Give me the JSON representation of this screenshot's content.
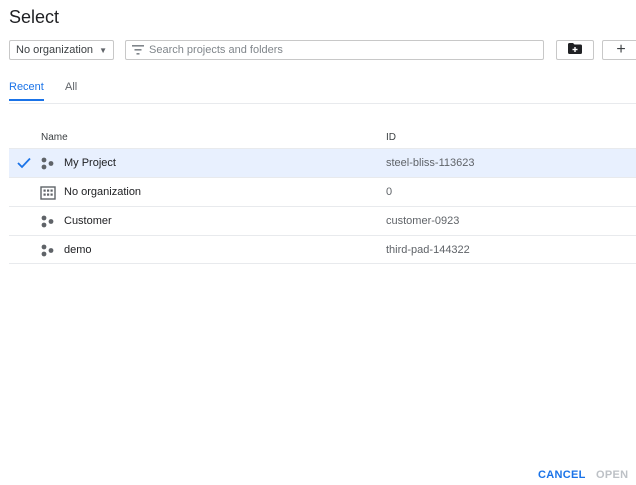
{
  "dialog": {
    "title": "Select"
  },
  "toolbar": {
    "org_select": {
      "value": "No organization"
    },
    "search": {
      "placeholder": "Search projects and folders"
    },
    "new_folder_icon": "folder-plus-icon",
    "new_project_label": "+"
  },
  "tabs": [
    {
      "label": "Recent",
      "active": true
    },
    {
      "label": "All",
      "active": false
    }
  ],
  "table": {
    "columns": {
      "name": "Name",
      "id": "ID"
    },
    "rows": [
      {
        "name": "My Project",
        "id": "steel-bliss-113623",
        "icon": "project-icon",
        "selected": true
      },
      {
        "name": "No organization",
        "id": "0",
        "icon": "organization-icon",
        "selected": false
      },
      {
        "name": "Customer",
        "id": "customer-0923",
        "icon": "project-icon",
        "selected": false
      },
      {
        "name": "demo",
        "id": "third-pad-144322",
        "icon": "project-icon",
        "selected": false
      }
    ]
  },
  "footer": {
    "cancel_label": "CANCEL",
    "open_label": "OPEN"
  },
  "colors": {
    "accent": "#1a73e8",
    "selected_row": "#e8f0fe",
    "disabled": "#bdc1c6"
  }
}
